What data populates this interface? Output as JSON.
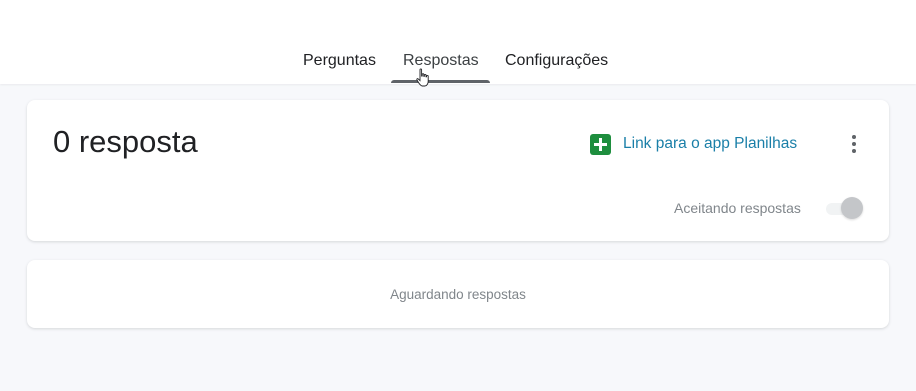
{
  "tabs": [
    {
      "label": "Perguntas"
    },
    {
      "label": "Respostas"
    },
    {
      "label": "Configurações"
    }
  ],
  "active_tab": "Respostas",
  "summary": {
    "count_text": "0 resposta",
    "link_label": "Link para o app Planilhas",
    "accepting_label": "Aceitando respostas",
    "accepting_enabled": false
  },
  "waiting": {
    "text": "Aguardando respostas"
  },
  "icons": {
    "sheets": "sheets-icon",
    "more": "more-vert-icon",
    "cursor": "hand-pointer-icon"
  },
  "colors": {
    "link": "#1a7fa8",
    "sheets_green": "#1e8e3e",
    "tab_indicator": "#5f6368"
  }
}
